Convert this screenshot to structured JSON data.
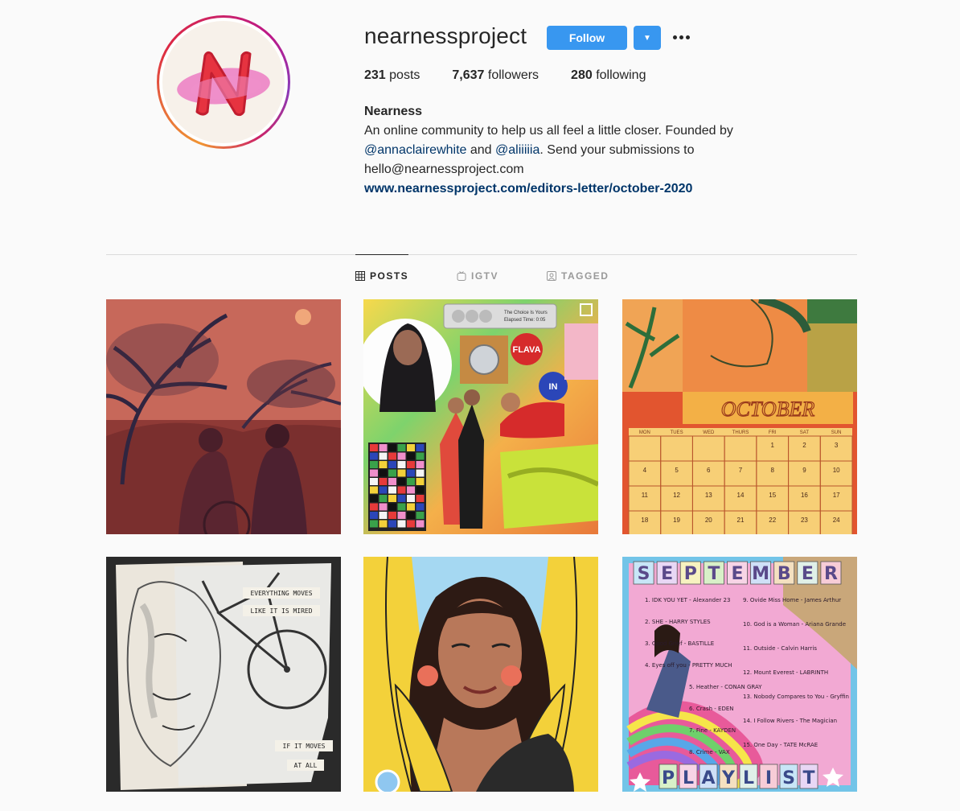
{
  "profile": {
    "username": "nearnessproject",
    "follow_label": "Follow",
    "avatar_letter": "N",
    "posts_count": "231",
    "posts_label": "posts",
    "followers_count": "7,637",
    "followers_label": "followers",
    "following_count": "280",
    "following_label": "following",
    "name": "Nearness",
    "bio_line1": "An online community to help us all feel a little closer. Founded by",
    "mention1": "@annaclairewhite",
    "and_text": " and ",
    "mention2": "@aliiiiia",
    "bio_line2_tail": ". Send your submissions to",
    "email": "hello@nearnessproject.com",
    "website": "www.nearnessproject.com/editors-letter/october-2020"
  },
  "tabs": {
    "posts": "POSTS",
    "igtv": "IGTV",
    "tagged": "TAGGED"
  },
  "posts": {
    "p2_player_text1": "The Choice Is Yours",
    "p2_player_text2": "Elapsed Time: 0:05",
    "p2_sticker_flava": "FLAVA",
    "p2_sticker_in": "IN",
    "p3_month": "OCTOBER",
    "p3_weekdays": [
      "MON",
      "TUES",
      "WED",
      "THURS",
      "FRI",
      "SAT",
      "SUN"
    ],
    "p3_days": [
      "",
      "",
      "",
      "",
      "1",
      "2",
      "3",
      "4",
      "5",
      "6",
      "7",
      "8",
      "9",
      "10",
      "11",
      "12",
      "13",
      "14",
      "15",
      "16",
      "17",
      "18",
      "19",
      "20",
      "21",
      "22",
      "23",
      "24"
    ],
    "p4_text1": "EVERYTHING MOVES",
    "p4_text2": "LIKE IT IS MIRED",
    "p4_text3": "IF IT MOVES",
    "p4_text4": "AT ALL",
    "p6_title": "SEPTEMBER",
    "p6_footer": "PLAYLIST",
    "p6_tracks_left": [
      "1. IDK YOU YET - Alexander 23",
      "2. SHE - HARRY STYLES",
      "3. Good Grief - BASTILLE",
      "4. Eyes off you - PRETTY MUCH",
      "5. Heather - CONAN GRAY",
      "6. Crash - EDEN",
      "7. Fine - KAYDEN",
      "8. Crime - VAX"
    ],
    "p6_tracks_right": [
      "9. Ovide Miss Home - James Arthur",
      "10. God is a Woman - Ariana Grande",
      "11. Outside - Calvin Harris",
      "12. Mount Everest - LABRINTH",
      "13. Nobody Compares to You - Gryffin",
      "14. I Follow Rivers - The Magician",
      "15. One Day - TATE McRAE"
    ]
  }
}
